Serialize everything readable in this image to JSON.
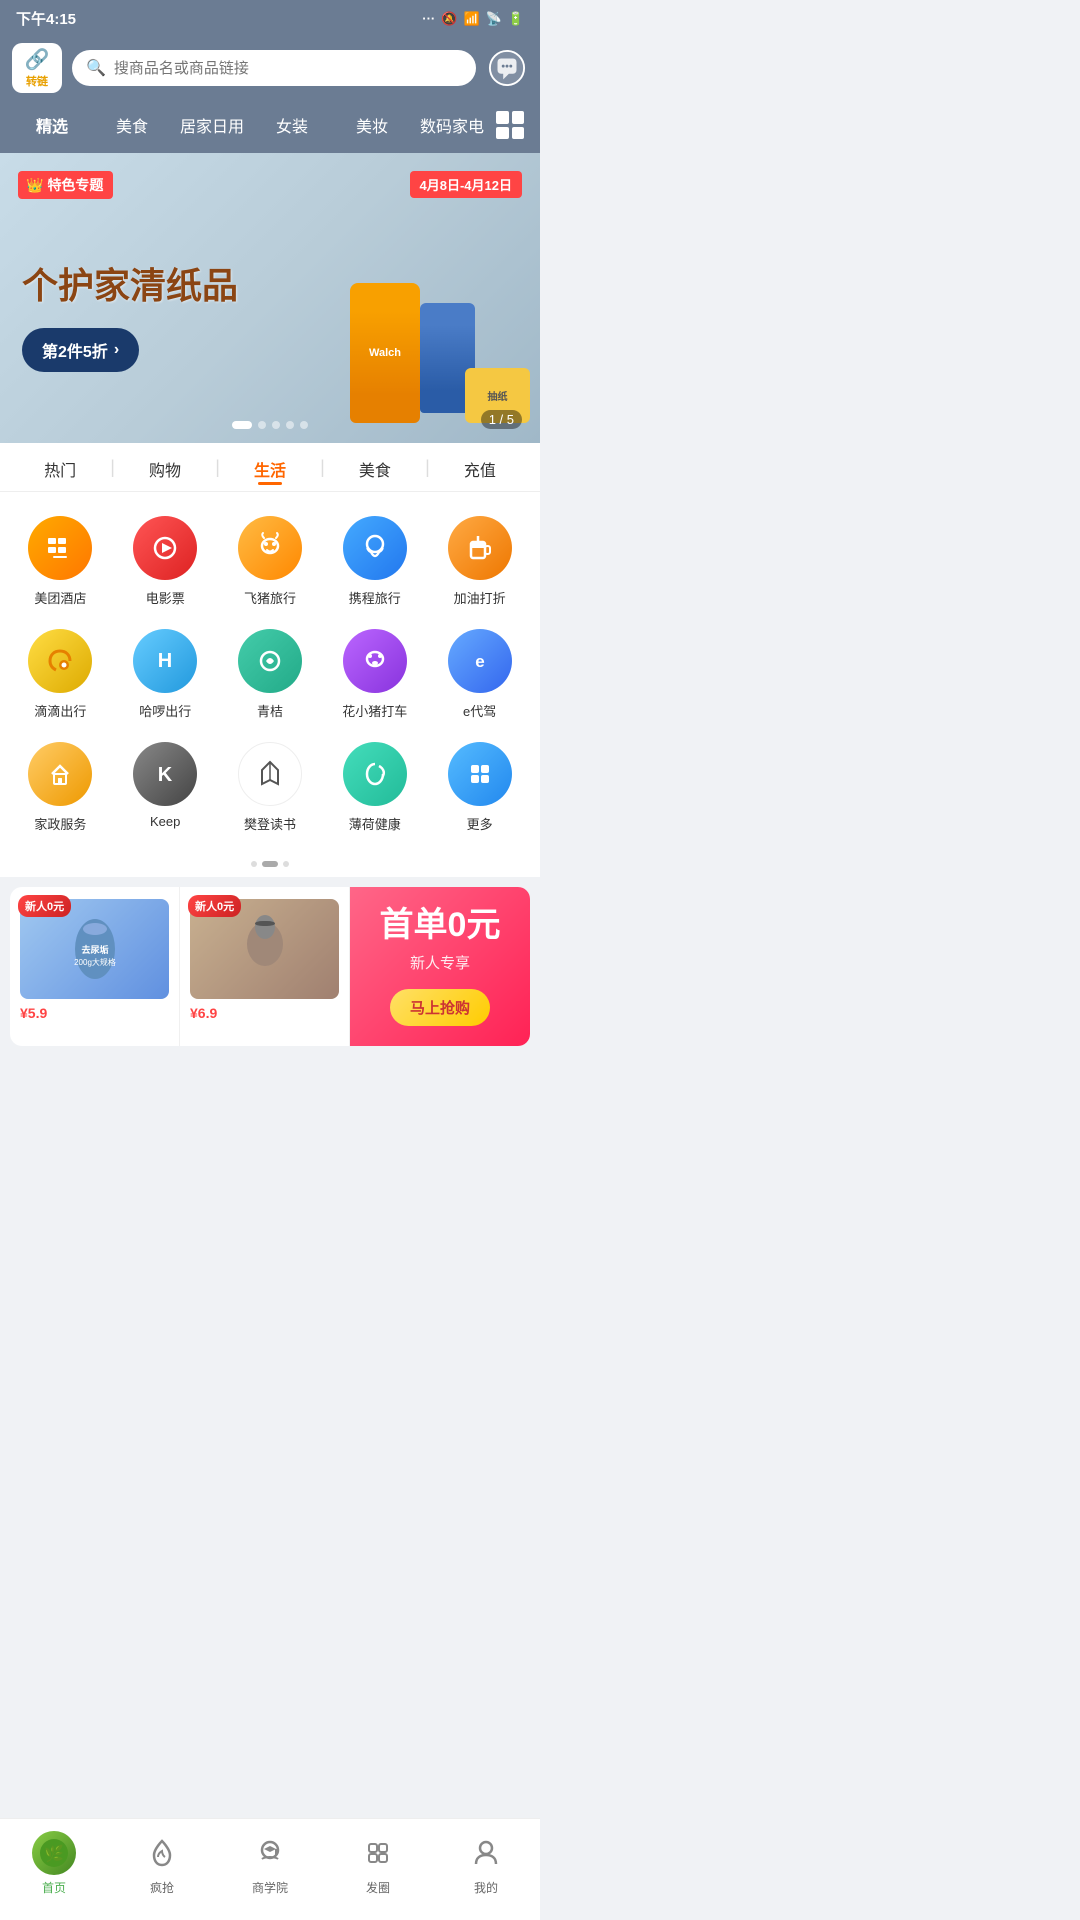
{
  "statusBar": {
    "time": "下午4:15"
  },
  "header": {
    "logoLabel": "转链",
    "searchPlaceholder": "搜商品名或商品链接"
  },
  "navTabs": [
    {
      "label": "精选",
      "active": true
    },
    {
      "label": "美食",
      "active": false
    },
    {
      "label": "居家日用",
      "active": false
    },
    {
      "label": "女装",
      "active": false
    },
    {
      "label": "美妆",
      "active": false
    },
    {
      "label": "数码家电",
      "active": false
    }
  ],
  "banner": {
    "tag": "特色专题",
    "date": "4月8日-4月12日",
    "title": "个护家清纸品",
    "btnLabel": "第2件5折",
    "indicator": "1 / 5"
  },
  "categoryTabs": [
    {
      "label": "热门",
      "active": false
    },
    {
      "label": "购物",
      "active": false
    },
    {
      "label": "生活",
      "active": true
    },
    {
      "label": "美食",
      "active": false
    },
    {
      "label": "充值",
      "active": false
    }
  ],
  "services": [
    {
      "label": "美团酒店",
      "icon": "🏨",
      "colorClass": "sc-orange"
    },
    {
      "label": "电影票",
      "icon": "🎬",
      "colorClass": "sc-red"
    },
    {
      "label": "飞猪旅行",
      "icon": "🐷",
      "colorClass": "sc-orange2"
    },
    {
      "label": "携程旅行",
      "icon": "🐬",
      "colorClass": "sc-blue"
    },
    {
      "label": "加油打折",
      "icon": "⛽",
      "colorClass": "sc-orange3"
    },
    {
      "label": "滴滴出行",
      "icon": "🚗",
      "colorClass": "sc-yellow"
    },
    {
      "label": "哈啰出行",
      "icon": "🚲",
      "colorClass": "sc-lightblue"
    },
    {
      "label": "青桔",
      "icon": "🟢",
      "colorClass": "sc-teal"
    },
    {
      "label": "花小猪打车",
      "icon": "🐷",
      "colorClass": "sc-purple"
    },
    {
      "label": "e代驾",
      "icon": "🚘",
      "colorClass": "sc-blue2"
    },
    {
      "label": "家政服务",
      "icon": "🏠",
      "colorClass": "sc-orange4"
    },
    {
      "label": "Keep",
      "icon": "K",
      "colorClass": "sc-dark"
    },
    {
      "label": "樊登读书",
      "icon": "📚",
      "colorClass": "sc-white"
    },
    {
      "label": "薄荷健康",
      "icon": "🍃",
      "colorClass": "sc-teal2"
    },
    {
      "label": "更多",
      "icon": "⋯",
      "colorClass": "sc-blue3"
    }
  ],
  "promoSection": {
    "card1Badge": "新人0元",
    "card1Price": "¥5.9",
    "card2Badge": "新人0元",
    "card2Price": "¥6.9",
    "rightTitle": "首单0元",
    "rightSub": "新人专享",
    "rightBtn": "马上抢购"
  },
  "bottomNav": [
    {
      "label": "首页",
      "active": true,
      "icon": "home"
    },
    {
      "label": "疯抢",
      "active": false,
      "icon": "fire"
    },
    {
      "label": "商学院",
      "active": false,
      "icon": "crown"
    },
    {
      "label": "发圈",
      "active": false,
      "icon": "grid"
    },
    {
      "label": "我的",
      "active": false,
      "icon": "person"
    }
  ]
}
